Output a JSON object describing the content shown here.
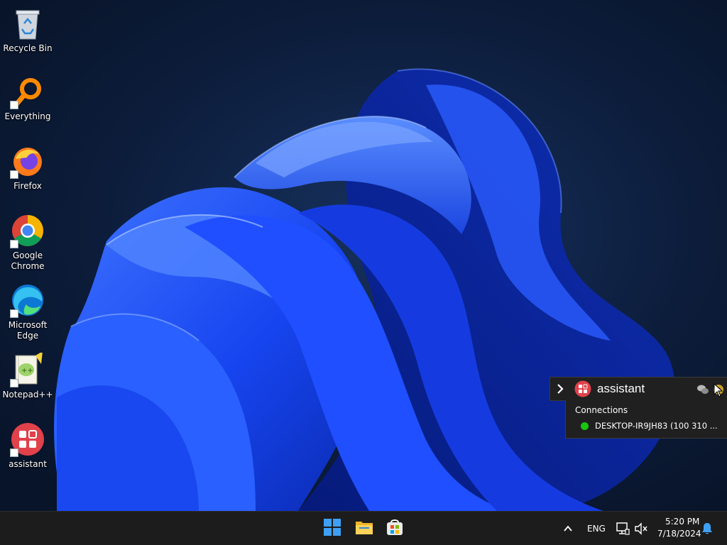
{
  "desktop": {
    "icons": [
      {
        "label": "Recycle Bin",
        "icon": "recycle-bin-icon"
      },
      {
        "label": "Everything",
        "icon": "everything-search-icon"
      },
      {
        "label": "Firefox",
        "icon": "firefox-icon"
      },
      {
        "label": "Google Chrome",
        "icon": "chrome-icon"
      },
      {
        "label": "Microsoft Edge",
        "icon": "edge-icon"
      },
      {
        "label": "Notepad++",
        "icon": "notepad-plus-plus-icon"
      },
      {
        "label": "assistant",
        "icon": "assistant-icon"
      }
    ]
  },
  "assistant_popup": {
    "title": "assistant",
    "section_label": "Connections",
    "connection": "DESKTOP-IR9JH83 (100 310 ...",
    "status_color": "#16c60c"
  },
  "taskbar": {
    "apps": [
      "start-icon",
      "file-explorer-icon",
      "microsoft-store-icon"
    ],
    "tray": {
      "language": "ENG",
      "time": "5:20 PM",
      "date": "7/18/2024"
    }
  },
  "colors": {
    "accent": "#0067c0",
    "wallpaper_blue": "#1f4fff",
    "taskbar": "#1c1c1c"
  }
}
